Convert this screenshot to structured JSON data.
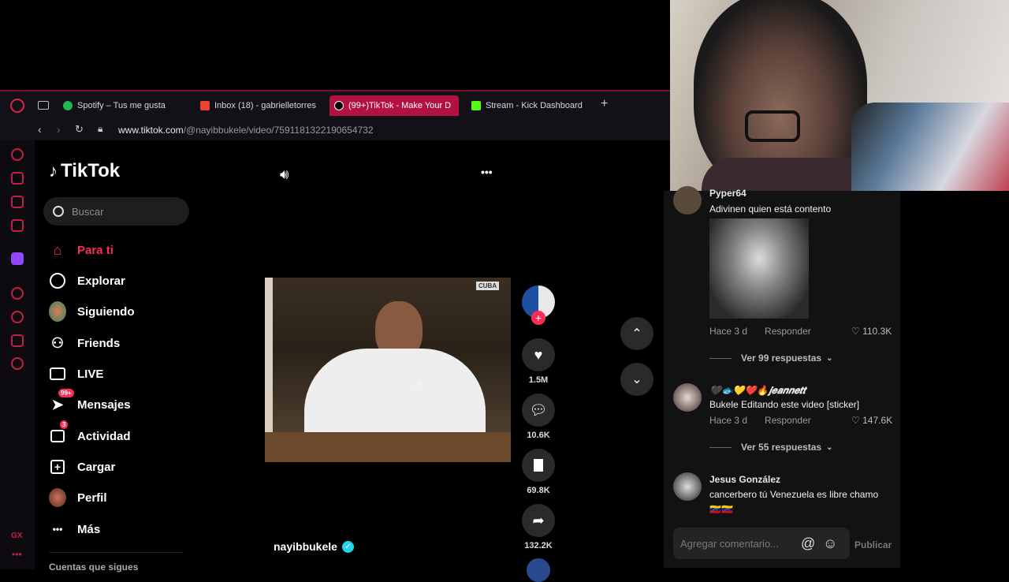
{
  "browser": {
    "tabs": [
      {
        "label": "Spotify – Tus me gusta",
        "icon": "spotify-icon",
        "color": "#1db954"
      },
      {
        "label": "Inbox (18) - gabrielletorres",
        "icon": "gmail-icon",
        "color": "#ea4335"
      },
      {
        "label": "(99+)TikTok - Make Your D",
        "icon": "tiktok-icon",
        "color": "#ffffff"
      },
      {
        "label": "Stream - Kick Dashboard",
        "icon": "kick-icon",
        "color": "#53fc18"
      }
    ],
    "url_domain": "www.tiktok.com",
    "url_path": "/@nayibbukele/video/7591181322190654732"
  },
  "tiktok": {
    "logo": "TikTok",
    "search_placeholder": "Buscar",
    "nav": [
      {
        "label": "Para ti",
        "icon": "home-icon",
        "selected": true
      },
      {
        "label": "Explorar",
        "icon": "compass-icon"
      },
      {
        "label": "Siguiendo",
        "icon": "following-avatar-icon"
      },
      {
        "label": "Friends",
        "icon": "friends-icon"
      },
      {
        "label": "LIVE",
        "icon": "live-tv-icon"
      },
      {
        "label": "Mensajes",
        "icon": "messages-icon",
        "badge": "99+"
      },
      {
        "label": "Actividad",
        "icon": "activity-icon",
        "badge": "3"
      },
      {
        "label": "Cargar",
        "icon": "upload-icon"
      },
      {
        "label": "Perfil",
        "icon": "profile-avatar-icon"
      },
      {
        "label": "Más",
        "icon": "more-dots-icon"
      }
    ],
    "following_header": "Cuentas que sigues",
    "video_watermark": "CUBA",
    "author": "nayibbukele",
    "actions": {
      "likes": "1.5M",
      "comments": "10.6K",
      "saves": "69.8K",
      "shares": "132.2K"
    },
    "accent": "#fe2c55"
  },
  "comments": [
    {
      "name": "Pyper64",
      "text": "Adivinen quien está contento",
      "time": "Hace 3 d",
      "reply": "Responder",
      "likes": "110.3K",
      "replies": "Ver 99 respuestas"
    },
    {
      "name": "🖤🐟💛❤️🔥𝒋𝒆𝒂𝒏𝒏𝒆𝒕𝒕",
      "text": "Bukele Editando este video [sticker]",
      "time": "Hace 3 d",
      "reply": "Responder",
      "likes": "147.6K",
      "replies": "Ver 55 respuestas"
    },
    {
      "name": "Jesus González",
      "text": "cancerbero tú Venezuela es libre chamo",
      "text2": "🇻🇪🇻🇪"
    }
  ],
  "comment_input": {
    "placeholder": "Agregar comentario...",
    "publish": "Publicar"
  },
  "opera_sidebar": {
    "gx_label": "GX"
  }
}
